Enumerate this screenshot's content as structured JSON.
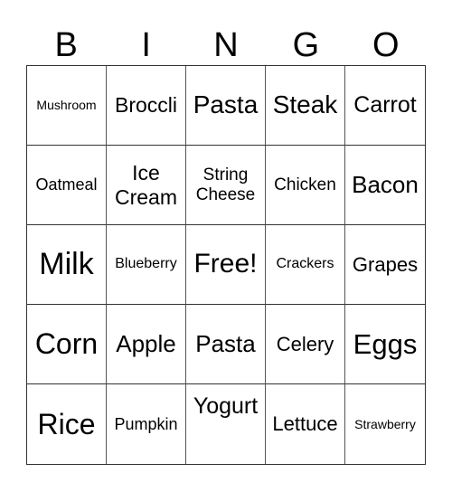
{
  "header": [
    "B",
    "I",
    "N",
    "G",
    "O"
  ],
  "cells": [
    {
      "text": "Mushroom",
      "size": 14
    },
    {
      "text": "Broccli",
      "size": 23
    },
    {
      "text": "Pasta",
      "size": 28
    },
    {
      "text": "Steak",
      "size": 28
    },
    {
      "text": "Carrot",
      "size": 25
    },
    {
      "text": "Oatmeal",
      "size": 18
    },
    {
      "text": "Ice Cream",
      "size": 23
    },
    {
      "text": "String Cheese",
      "size": 19
    },
    {
      "text": "Chicken",
      "size": 19
    },
    {
      "text": "Bacon",
      "size": 26
    },
    {
      "text": "Milk",
      "size": 34
    },
    {
      "text": "Blueberry",
      "size": 16
    },
    {
      "text": "Free!",
      "size": 30
    },
    {
      "text": "Crackers",
      "size": 16
    },
    {
      "text": "Grapes",
      "size": 22
    },
    {
      "text": "Corn",
      "size": 32
    },
    {
      "text": "Apple",
      "size": 26
    },
    {
      "text": "Pasta",
      "size": 26
    },
    {
      "text": "Celery",
      "size": 22
    },
    {
      "text": "Eggs",
      "size": 31
    },
    {
      "text": "Rice",
      "size": 32
    },
    {
      "text": "Pumpkin",
      "size": 18
    },
    {
      "text": "Yogurt",
      "size": 25,
      "align": "top"
    },
    {
      "text": "Lettuce",
      "size": 22
    },
    {
      "text": "Strawberry",
      "size": 14
    }
  ]
}
